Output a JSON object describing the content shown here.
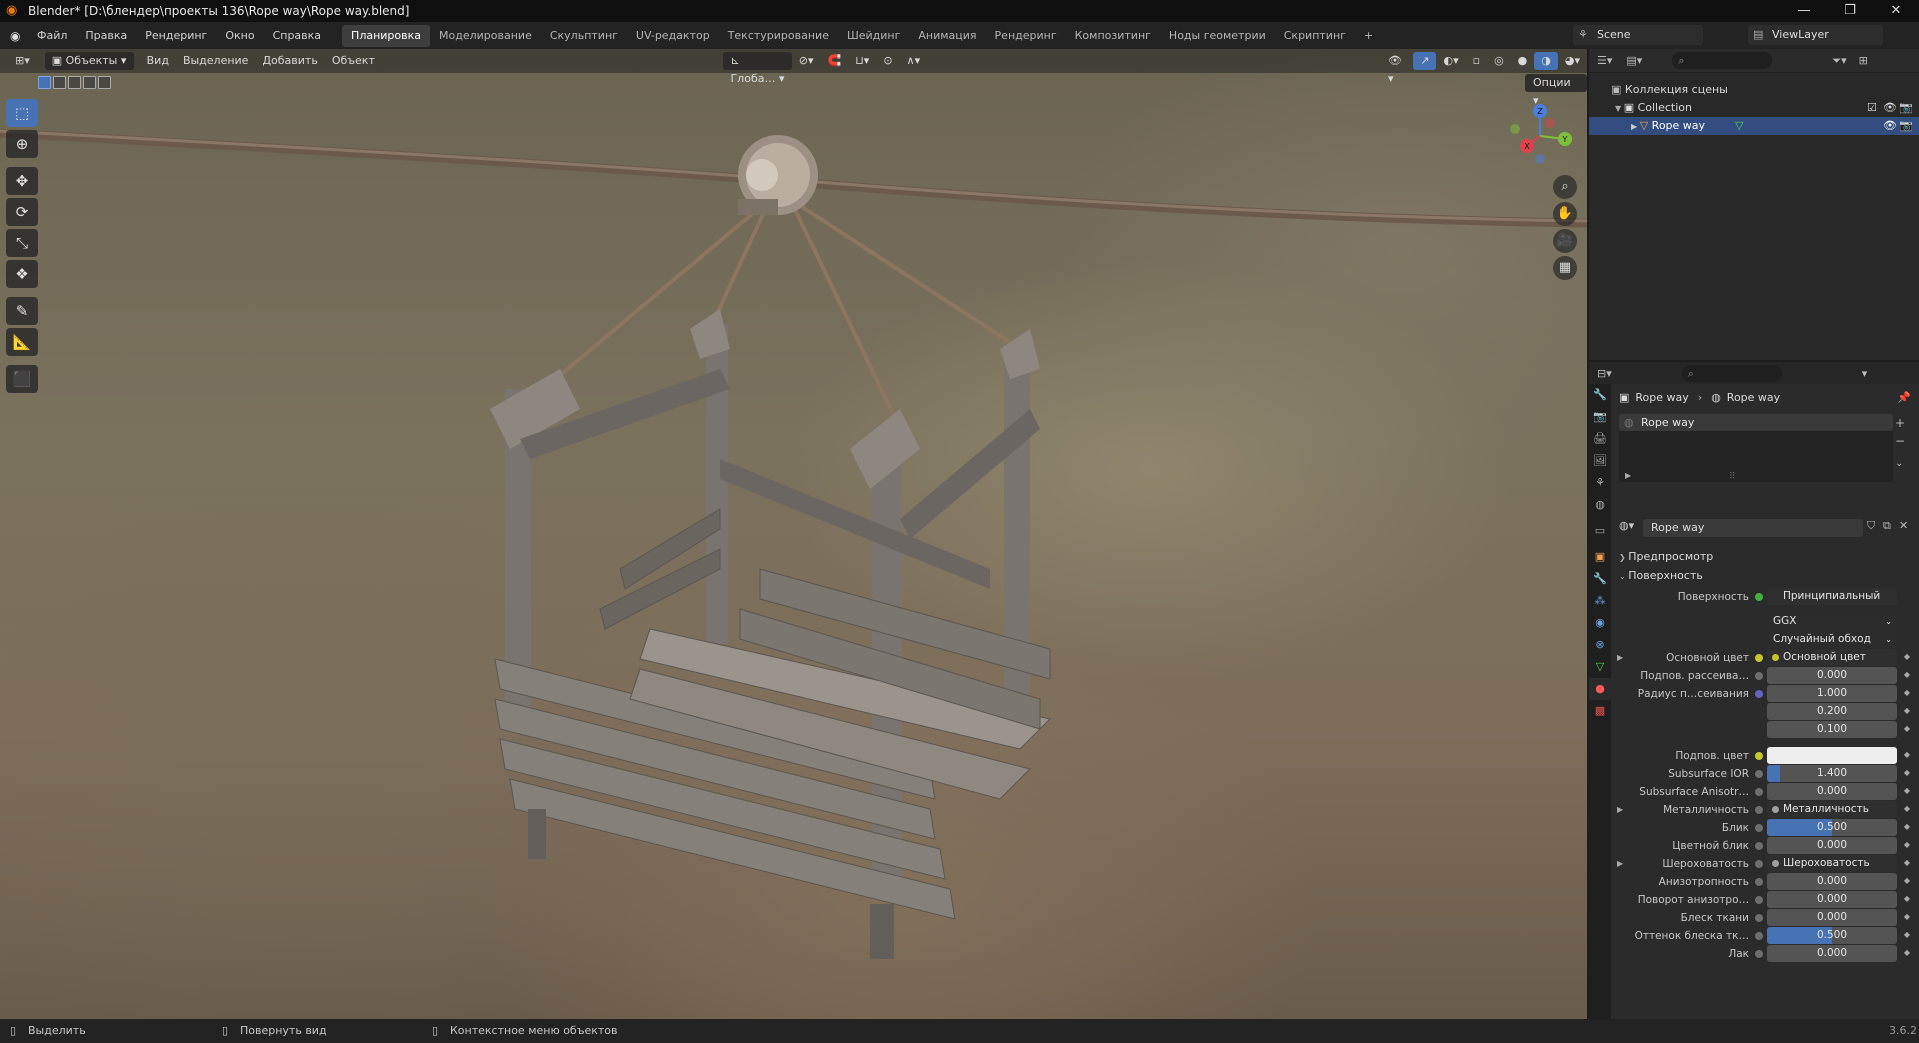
{
  "window": {
    "title": "Blender* [D:\\блендер\\проекты 136\\Rope way\\Rope way.blend]",
    "controls": [
      "—",
      "❐",
      "✕"
    ]
  },
  "menu": [
    "Файл",
    "Правка",
    "Рендеринг",
    "Окно",
    "Справка"
  ],
  "workspaces": {
    "active": "Планировка",
    "tabs": [
      "Моделирование",
      "Скульптинг",
      "UV-редактор",
      "Текстурирование",
      "Шейдинг",
      "Анимация",
      "Рендеринг",
      "Композитинг",
      "Ноды геометрии",
      "Скриптинг"
    ],
    "add": "+"
  },
  "scene": {
    "name": "Scene",
    "view_layer": "ViewLayer"
  },
  "viewport_header": {
    "mode": "Объекты",
    "menus": [
      "Вид",
      "Выделение",
      "Добавить",
      "Объект"
    ],
    "orientation": "Глоба…",
    "options": "Опции"
  },
  "toolbar": {
    "tools": [
      "select-box",
      "cursor",
      "move",
      "rotate",
      "scale",
      "transform",
      "annotate",
      "measure",
      "add-cube"
    ],
    "active": "select-box"
  },
  "gizmo_labels": {
    "x": "X",
    "y": "Y",
    "z": "Z"
  },
  "outliner": {
    "root": "Коллекция сцены",
    "collection": "Collection",
    "object": "Rope way"
  },
  "properties": {
    "breadcrumb": [
      "Rope way",
      "Rope way"
    ],
    "slot": "Rope way",
    "material_name": "Rope way",
    "panels": {
      "preview": "Предпросмотр",
      "surface": "Поверхность"
    },
    "surface_label": "Поверхность",
    "surface_shader": "Принципиальный BSDF",
    "distribution": "GGX",
    "subsurface_method": "Случайный обход",
    "rows": [
      {
        "label": "Основной цвет",
        "value": "Основной цвет",
        "kind": "link",
        "dot": "color",
        "arrow": true
      },
      {
        "label": "Подпов. рассеива…",
        "value": "0.000",
        "kind": "num",
        "dot": "grey"
      },
      {
        "label": "Радиус п…сеивания",
        "value": "1.000",
        "kind": "num",
        "dot": "vec"
      },
      {
        "label": "",
        "value": "0.200",
        "kind": "num",
        "dot": ""
      },
      {
        "label": "",
        "value": "0.100",
        "kind": "num",
        "dot": ""
      },
      {
        "label": "Подпов. цвет",
        "value": "",
        "kind": "swatch",
        "dot": "color"
      },
      {
        "label": "Subsurface IOR",
        "value": "1.400",
        "kind": "num",
        "dot": "grey",
        "fill": 0.1
      },
      {
        "label": "Subsurface Anisotr…",
        "value": "0.000",
        "kind": "num",
        "dot": "grey"
      },
      {
        "label": "Металличность",
        "value": "Металличность",
        "kind": "link",
        "dot": "grey",
        "arrow": true
      },
      {
        "label": "Блик",
        "value": "0.500",
        "kind": "num",
        "dot": "grey",
        "fill": 0.5
      },
      {
        "label": "Цветной блик",
        "value": "0.000",
        "kind": "num",
        "dot": "grey"
      },
      {
        "label": "Шероховатость",
        "value": "Шероховатость",
        "kind": "link",
        "dot": "grey",
        "arrow": true
      },
      {
        "label": "Анизотропность",
        "value": "0.000",
        "kind": "num",
        "dot": "grey"
      },
      {
        "label": "Поворот анизотро…",
        "value": "0.000",
        "kind": "num",
        "dot": "grey"
      },
      {
        "label": "Блеск ткани",
        "value": "0.000",
        "kind": "num",
        "dot": "grey"
      },
      {
        "label": "Оттенок блеска тк…",
        "value": "0.500",
        "kind": "num",
        "dot": "grey",
        "fill": 0.5
      },
      {
        "label": "Лак",
        "value": "0.000",
        "kind": "num",
        "dot": "grey"
      }
    ]
  },
  "status": {
    "select": "Выделить",
    "rotate": "Повернуть вид",
    "context": "Контекстное меню объектов",
    "version": "3.6.2"
  }
}
